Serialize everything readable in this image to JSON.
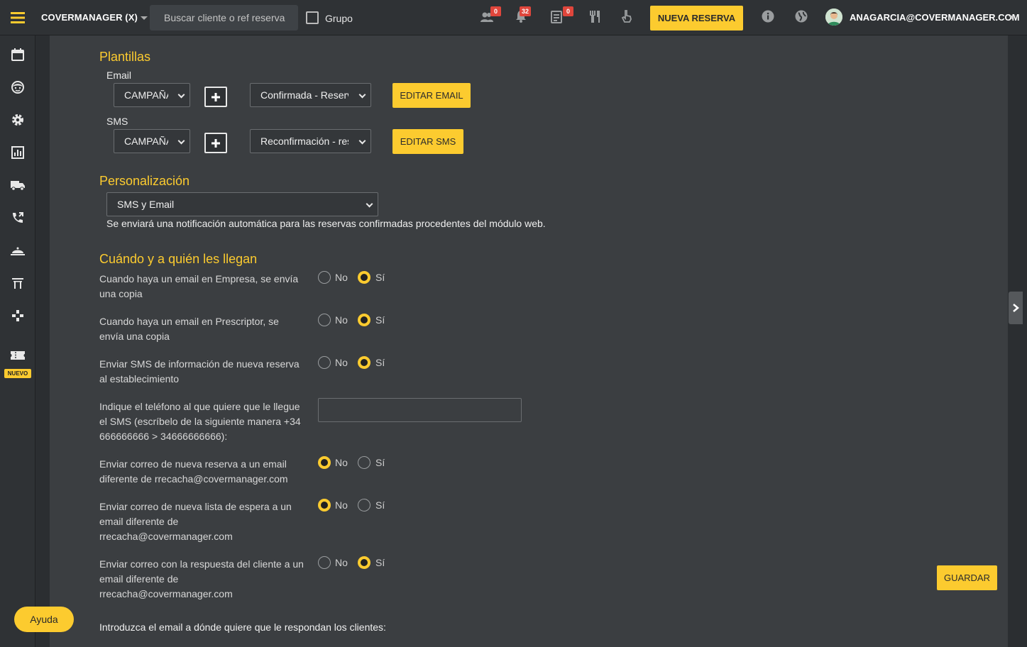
{
  "header": {
    "brand": "COVERMANAGER (X)",
    "search_placeholder": "Buscar cliente o ref reserva",
    "grupo_label": "Grupo",
    "badges": {
      "groups": "0",
      "notifications": "32",
      "tasks": "0"
    },
    "new_reservation": "NUEVA RESERVA",
    "user_email": "ANAGARCIA@COVERMANAGER.COM"
  },
  "sidebar": {
    "items": [
      "calendar-icon",
      "smiley-icon",
      "gear-icon",
      "chart-icon",
      "truck-icon",
      "phone-icon",
      "cloche-icon",
      "arch-icon",
      "gamepad-icon",
      "ticket-icon"
    ],
    "new_tag": "NUEVO"
  },
  "templates": {
    "title": "Plantillas",
    "email_label": "Email",
    "email_category": "CAMPAÑA",
    "email_template": "Confirmada - Reserva",
    "edit_email": "EDITAR EMAIL",
    "sms_label": "SMS",
    "sms_category": "CAMPAÑA",
    "sms_template": "Reconfirmación - reserva",
    "edit_sms": "EDITAR SMS"
  },
  "personalization": {
    "title": "Personalización",
    "selected": "SMS y Email",
    "note": "Se enviará una notificación automática para las reservas confirmadas procedentes del módulo web."
  },
  "recipients": {
    "title": "Cuándo y a quién les llegan",
    "no_label": "No",
    "yes_label": "Sí",
    "questions": [
      {
        "label": "Cuando haya un email en Empresa, se envía una copia",
        "value": "Sí"
      },
      {
        "label": "Cuando haya un email en Prescriptor, se envía una copia",
        "value": "Sí"
      },
      {
        "label": "Enviar SMS de información de nueva reserva al establecimiento",
        "value": "Sí"
      },
      {
        "label": "Enviar correo de nueva reserva a un email diferente de rrecacha@covermanager.com",
        "value": "No"
      },
      {
        "label": "Enviar correo de nueva lista de espera a un email diferente de rrecacha@covermanager.com",
        "value": "No"
      },
      {
        "label": "Enviar correo con la respuesta del cliente a un email diferente de rrecacha@covermanager.com",
        "value": "Sí"
      }
    ],
    "phone_label": "Indique el teléfono al que quiere que le llegue el SMS (escríbelo de la siguiente manera +34 666666666 > 34666666666):",
    "phone_value": "",
    "reply_email_label": "Introduzca el email a dónde quiere que le respondan los clientes:"
  },
  "save": "GUARDAR",
  "help": "Ayuda",
  "colors": {
    "accent": "#fccb2f",
    "panel": "#3b3e41",
    "bar": "#2f3235"
  }
}
